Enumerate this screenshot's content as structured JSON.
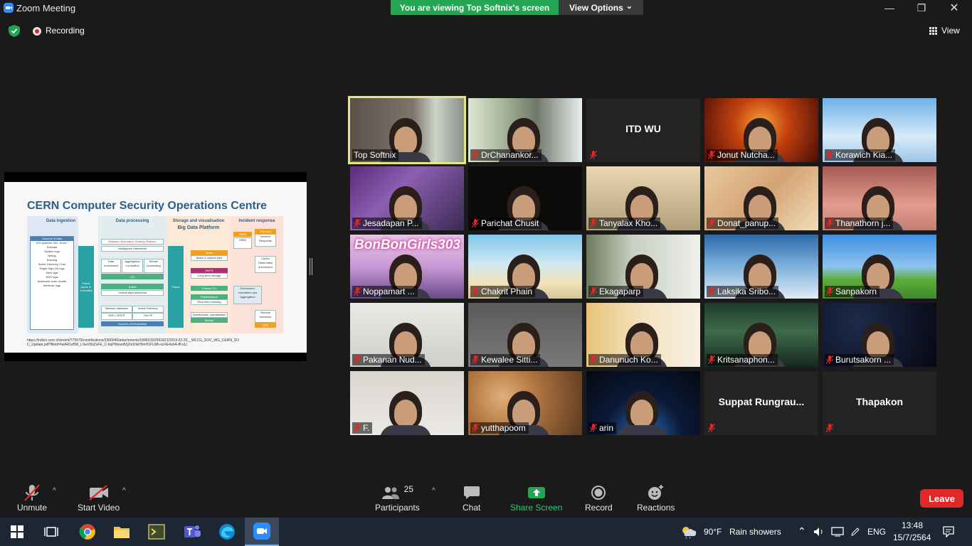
{
  "window": {
    "title": "Zoom Meeting",
    "viewing_banner": "You are viewing Top Softnix's screen",
    "view_options": "View Options",
    "view_options_caret": "⌄",
    "minimize": "—",
    "restore": "❐",
    "close": "✕"
  },
  "status": {
    "recording": "Recording",
    "view": "View"
  },
  "shared_screen": {
    "slide_title": "CERN Computer Security Operations Centre",
    "columns": [
      "Data ingestion",
      "Data processing",
      "Storage and visualisation",
      "Incident response"
    ],
    "big_data": "Big Data Platform",
    "sources_of_data": "Sources of data",
    "sources": [
      "IDS systems: Bro, Snort / Suricata",
      "System logs",
      "Netlog",
      "Execlog",
      "Active Directory / Kds",
      "Single Sign-On logs",
      "Web logs",
      "DNS logs",
      "Automatic scan results",
      "Webhole logs"
    ],
    "misp": "Malware Information Sharing Platform",
    "intel_fw": "Intelligence framework",
    "enrich": "Data enrichment",
    "aggregation": "Aggregation Correlation",
    "stream": "Stream processing",
    "go": "Go",
    "kafka": "Kafka",
    "central": "Central data backbone",
    "netdb": "Network database",
    "ad": "Active Directory",
    "dns": "DNS / DHCP",
    "geoip": "Geo IP",
    "sources_info": "Sources of information",
    "flume_left": "Flume parse & normalise",
    "flume_right": "Flume",
    "spark": "Spark",
    "batch": "Batch & custom jobs",
    "hdfs": "HDFS",
    "long_term": "Long term storage",
    "custom_cli": "Custom CLI",
    "elastic": "Elasticsearch",
    "realtime": "Real time indexing",
    "kibana": "Kibana",
    "dashboards": "Dashboards / visualisation",
    "siem": "SIEM",
    "hive": "The Hive",
    "incident_resp": "Incident Response",
    "cortex": "Cortex",
    "observable": "Observable enrichment",
    "enrichment": "Enrichment, correlation and aggregation",
    "remote": "Remote forensics",
    "grr": "GRR",
    "url": "https://indico.cern.ch/event/775579/contributions/3306040/attachments/1808103/2951821/2019-02-20__WLCG_SOC_WG_CERN_SOC_Update.pdf?fileId=IwAR1vBW_LSwV8oZsFE_C-6qPMywdlVj2m1hkP9mH1FLMh-sxXE4uhA-8f-uU"
  },
  "participants_tiles": [
    {
      "name": "Top Softnix",
      "muted": false,
      "active": true
    },
    {
      "name": "DrChanankor...",
      "muted": true
    },
    {
      "name": "ITD WU",
      "muted": true,
      "video_off": true
    },
    {
      "name": "Jonut Nutcha...",
      "muted": true
    },
    {
      "name": "Korawich Kia...",
      "muted": true
    },
    {
      "name": "Jesadapan P...",
      "muted": true
    },
    {
      "name": "Parichat Chusit",
      "muted": true
    },
    {
      "name": "Tanyalax Kho...",
      "muted": true
    },
    {
      "name": "Donat_panup...",
      "muted": true
    },
    {
      "name": "Thanathorn j...",
      "muted": true
    },
    {
      "name": "Noppamart ...",
      "muted": true,
      "overlay_text": "BonBonGirls303"
    },
    {
      "name": "Chakrit Phain",
      "muted": true
    },
    {
      "name": "Ekagaparp",
      "muted": true
    },
    {
      "name": "Laksika Sribo...",
      "muted": true
    },
    {
      "name": "Sanpakorn",
      "muted": true
    },
    {
      "name": "Pakanan Nud...",
      "muted": true
    },
    {
      "name": "Kewalee Sitti...",
      "muted": true
    },
    {
      "name": "Danunuch Ko...",
      "muted": true
    },
    {
      "name": "Kritsanaphon...",
      "muted": true
    },
    {
      "name": "Burutsakorn ...",
      "muted": true
    },
    {
      "name": "F.",
      "muted": true
    },
    {
      "name": "yutthapoom",
      "muted": true
    },
    {
      "name": "arin",
      "muted": true
    },
    {
      "name": "Suppat  Rungrau...",
      "muted": true,
      "video_off": true
    },
    {
      "name": "Thapakon",
      "muted": true,
      "video_off": true
    }
  ],
  "toolbar": {
    "unmute": "Unmute",
    "start_video": "Start Video",
    "participants": "Participants",
    "participant_count": "25",
    "chat": "Chat",
    "share_screen": "Share Screen",
    "record": "Record",
    "reactions": "Reactions",
    "leave": "Leave",
    "caret": "^"
  },
  "taskbar": {
    "weather_temp": "90°F",
    "weather_desc": "Rain showers",
    "lang": "ENG",
    "time": "13:48",
    "date": "15/7/2564"
  },
  "colors": {
    "accent_green": "#23a554",
    "leave_red": "#e02828",
    "active_speaker": "#e7e775",
    "zoom_blue": "#2d8cff"
  }
}
